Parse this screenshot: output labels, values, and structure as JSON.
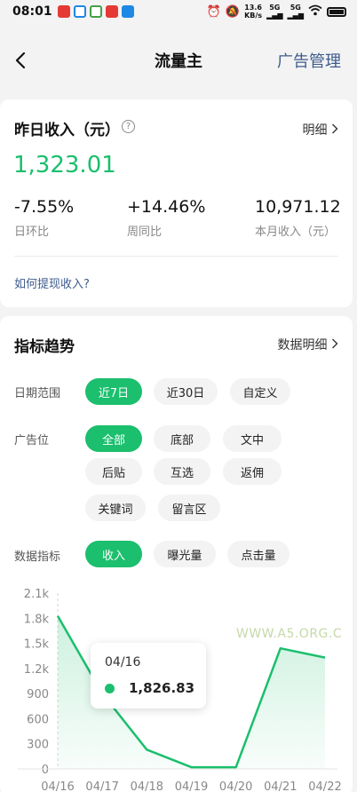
{
  "status_bar": {
    "time": "08:01",
    "net_speed": "13.6",
    "net_unit": "KB/s",
    "net1": "5G",
    "net2": "5G"
  },
  "nav": {
    "title": "流量主",
    "right_action": "广告管理"
  },
  "income": {
    "title": "昨日收入（元）",
    "detail_label": "明细",
    "amount": "1,323.01",
    "stats": [
      {
        "value": "-7.55%",
        "label": "日环比"
      },
      {
        "value": "+14.46%",
        "label": "周同比"
      },
      {
        "value": "10,971.12",
        "label": "本月收入（元）"
      }
    ],
    "withdraw_link": "如何提现收入?"
  },
  "trend": {
    "title": "指标趋势",
    "detail_label": "数据明细",
    "date_range": {
      "label": "日期范围",
      "options": [
        "近7日",
        "近30日",
        "自定义"
      ],
      "selected": "近7日"
    },
    "ad_slot": {
      "label": "广告位",
      "options": [
        "全部",
        "底部",
        "文中",
        "后贴",
        "互选",
        "返佣",
        "关键词",
        "留言区"
      ],
      "selected": "全部"
    },
    "metric": {
      "label": "数据指标",
      "options": [
        "收入",
        "曝光量",
        "点击量"
      ],
      "selected": "收入"
    }
  },
  "watermark": "WWW.A5.ORG.C",
  "tooltip": {
    "date": "04/16",
    "value": "1,826.83"
  },
  "colors": {
    "accent": "#1bbf6d",
    "link": "#3d5b8c"
  },
  "chart_data": {
    "type": "area",
    "x": [
      "04/16",
      "04/17",
      "04/18",
      "04/19",
      "04/20",
      "04/21",
      "04/22"
    ],
    "series": [
      {
        "values": [
          1826.83,
          900,
          230,
          20,
          20,
          1440,
          1330
        ]
      }
    ],
    "y_ticks": [
      "0",
      "300",
      "600",
      "900",
      "1.2k",
      "1.5k",
      "1.8k",
      "2.1k"
    ],
    "ylim": [
      0,
      2100
    ],
    "grid": false
  }
}
